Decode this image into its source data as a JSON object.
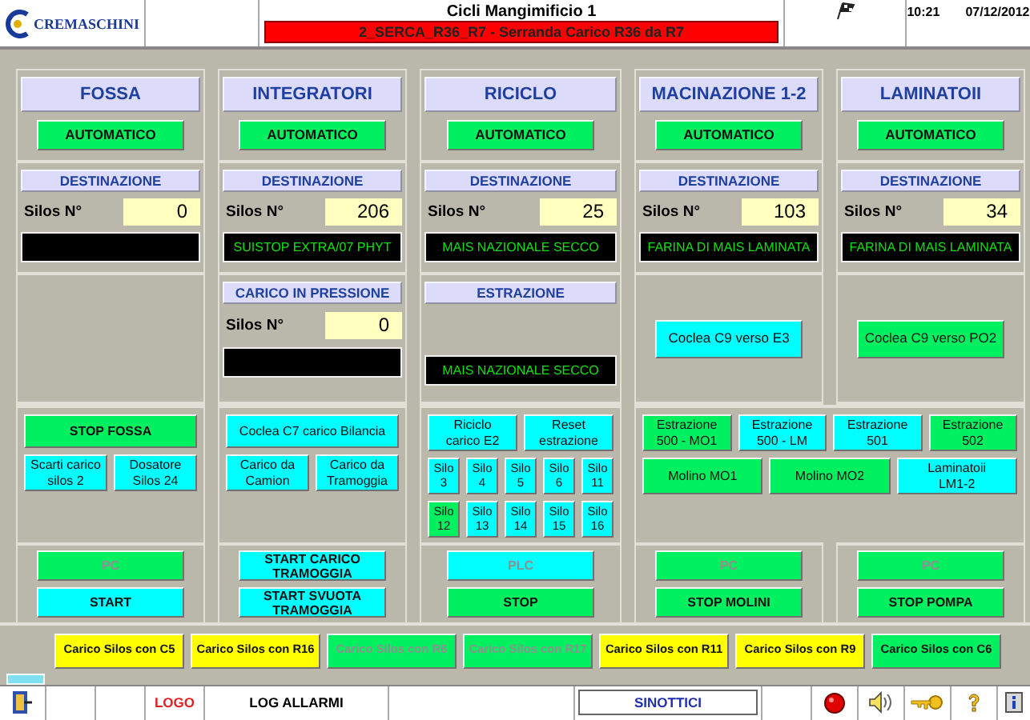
{
  "header": {
    "logo": "CREMASCHINI",
    "title": "Cicli Mangimificio 1",
    "alarm": "2_SERCA_R36_R7 - Serranda Carico R36 da R7",
    "time": "10:21",
    "date": "07/12/2012"
  },
  "columns": [
    {
      "title": "FOSSA",
      "mode": {
        "label": "AUTOMATICO",
        "color": "#00f060"
      },
      "destination": {
        "label": "DESTINAZIONE",
        "silos_label": "Silos N°",
        "silos_value": "0"
      }
    },
    {
      "title": "INTEGRATORI",
      "mode": {
        "label": "AUTOMATICO",
        "color": "#00f060"
      },
      "destination": {
        "label": "DESTINAZIONE",
        "silos_label": "Silos N°",
        "silos_value": "206",
        "product": "SUISTOP EXTRA/07 PHYT"
      },
      "middle": {
        "kind": "silos",
        "label": "CARICO IN PRESSIONE",
        "silos_label": "Silos N°",
        "silos_value": "0"
      }
    },
    {
      "title": "RICICLO",
      "mode": {
        "label": "AUTOMATICO",
        "color": "#00f060"
      },
      "destination": {
        "label": "DESTINAZIONE",
        "silos_label": "Silos N°",
        "silos_value": "25",
        "product": "MAIS NAZIONALE SECCO"
      },
      "middle": {
        "kind": "product",
        "label": "ESTRAZIONE",
        "product": "MAIS NAZIONALE SECCO"
      }
    },
    {
      "title": "MACINAZIONE 1-2",
      "mode": {
        "label": "AUTOMATICO",
        "color": "#00f060"
      },
      "destination": {
        "label": "DESTINAZIONE",
        "silos_label": "Silos N°",
        "silos_value": "103",
        "product": "FARINA DI MAIS LAMINATA"
      },
      "middle": {
        "kind": "button",
        "button": {
          "label": "Coclea C9 verso E3",
          "color": "#00ffff"
        }
      }
    },
    {
      "title": "LAMINATOII",
      "mode": {
        "label": "AUTOMATICO",
        "color": "#00f060"
      },
      "destination": {
        "label": "DESTINAZIONE",
        "silos_label": "Silos N°",
        "silos_value": "34",
        "product": "FARINA DI MAIS LAMINATA"
      },
      "middle": {
        "kind": "button",
        "button": {
          "label": "Coclea C9 verso PO2",
          "color": "#00f060"
        }
      }
    }
  ],
  "action_panels": [
    {
      "groups": [
        [
          {
            "label": "STOP FOSSA",
            "color": "#00f060",
            "bold": true
          }
        ],
        [
          {
            "label": "Scarti carico\nsilos 2",
            "color": "#00ffff",
            "bold": false
          },
          {
            "label": "Dosatore\nSilos 24",
            "color": "#00ffff",
            "bold": false
          }
        ]
      ]
    },
    {
      "groups": [
        [
          {
            "label": "Coclea C7 carico Bilancia",
            "color": "#00ffff",
            "bold": false
          }
        ],
        [
          {
            "label": "Carico da\nCamion",
            "color": "#00ffff",
            "bold": false
          },
          {
            "label": "Carico da\nTramoggia",
            "color": "#00ffff",
            "bold": false
          }
        ]
      ]
    },
    {
      "groups": [
        [
          {
            "label": "Riciclo\ncarico E2",
            "color": "#00ffff",
            "bold": false
          },
          {
            "label": "Reset\nestrazione",
            "color": "#00ffff",
            "bold": false
          }
        ],
        [
          {
            "label": "Silo\n3",
            "color": "#00ffff",
            "bold": false
          },
          {
            "label": "Silo\n4",
            "color": "#00ffff",
            "bold": false
          },
          {
            "label": "Silo\n5",
            "color": "#00ffff",
            "bold": false
          },
          {
            "label": "Silo\n6",
            "color": "#00ffff",
            "bold": false
          },
          {
            "label": "Silo\n11",
            "color": "#00ffff",
            "bold": false
          }
        ],
        [
          {
            "label": "Silo\n12",
            "color": "#00f060",
            "bold": false
          },
          {
            "label": "Silo\n13",
            "color": "#00ffff",
            "bold": false
          },
          {
            "label": "Silo\n14",
            "color": "#00ffff",
            "bold": false
          },
          {
            "label": "Silo\n15",
            "color": "#00ffff",
            "bold": false
          },
          {
            "label": "Silo\n16",
            "color": "#00ffff",
            "bold": false
          }
        ]
      ]
    },
    {
      "groups": [
        [
          {
            "label": "Estrazione\n500 - MO1",
            "color": "#00f060",
            "bold": false
          },
          {
            "label": "Estrazione\n500 - LM",
            "color": "#00ffff",
            "bold": false
          },
          {
            "label": "Estrazione\n501",
            "color": "#00ffff",
            "bold": false
          },
          {
            "label": "Estrazione\n502",
            "color": "#00f060",
            "bold": false
          }
        ],
        [
          {
            "label": "Molino MO1",
            "color": "#00f060",
            "bold": false
          },
          {
            "label": "Molino MO2",
            "color": "#00f060",
            "bold": false
          },
          {
            "label": "Laminatoii\nLM1-2",
            "color": "#00ffff",
            "bold": false
          }
        ]
      ]
    }
  ],
  "control_panels": [
    [
      {
        "label": "PC",
        "color": "#00f060",
        "disabled": true
      },
      {
        "label": "START",
        "color": "#00ffff",
        "disabled": false
      }
    ],
    [
      {
        "label": "START CARICO\nTRAMOGGIA",
        "color": "#00ffff",
        "disabled": false
      },
      {
        "label": "START SVUOTA\nTRAMOGGIA",
        "color": "#00ffff",
        "disabled": false
      }
    ],
    [
      {
        "label": "PLC",
        "color": "#00ffff",
        "disabled": true
      },
      {
        "label": "STOP",
        "color": "#00f060",
        "disabled": false
      }
    ],
    [
      {
        "label": "PC",
        "color": "#00f060",
        "disabled": true
      },
      {
        "label": "STOP MOLINI",
        "color": "#00f060",
        "disabled": false
      }
    ],
    [
      {
        "label": "PC",
        "color": "#00f060",
        "disabled": true
      },
      {
        "label": "STOP POMPA",
        "color": "#00f060",
        "disabled": false
      }
    ]
  ],
  "load_buttons": [
    {
      "label": "Carico Silos con C5",
      "color": "#ffff00",
      "disabled": false
    },
    {
      "label": "Carico Silos con R16",
      "color": "#ffff00",
      "disabled": false
    },
    {
      "label": "Carico Silos con R6",
      "color": "#00f060",
      "disabled": true
    },
    {
      "label": "Carico Silos con R17",
      "color": "#00f060",
      "disabled": true
    },
    {
      "label": "Carico Silos con R11",
      "color": "#ffff00",
      "disabled": false
    },
    {
      "label": "Carico Silos con R9",
      "color": "#ffff00",
      "disabled": false
    },
    {
      "label": "Carico Silos con C6",
      "color": "#00f060",
      "disabled": false
    }
  ],
  "footer": {
    "logo": "LOGO",
    "alarms": "LOG ALLARMI",
    "synoptics": "SINOTTICI"
  }
}
